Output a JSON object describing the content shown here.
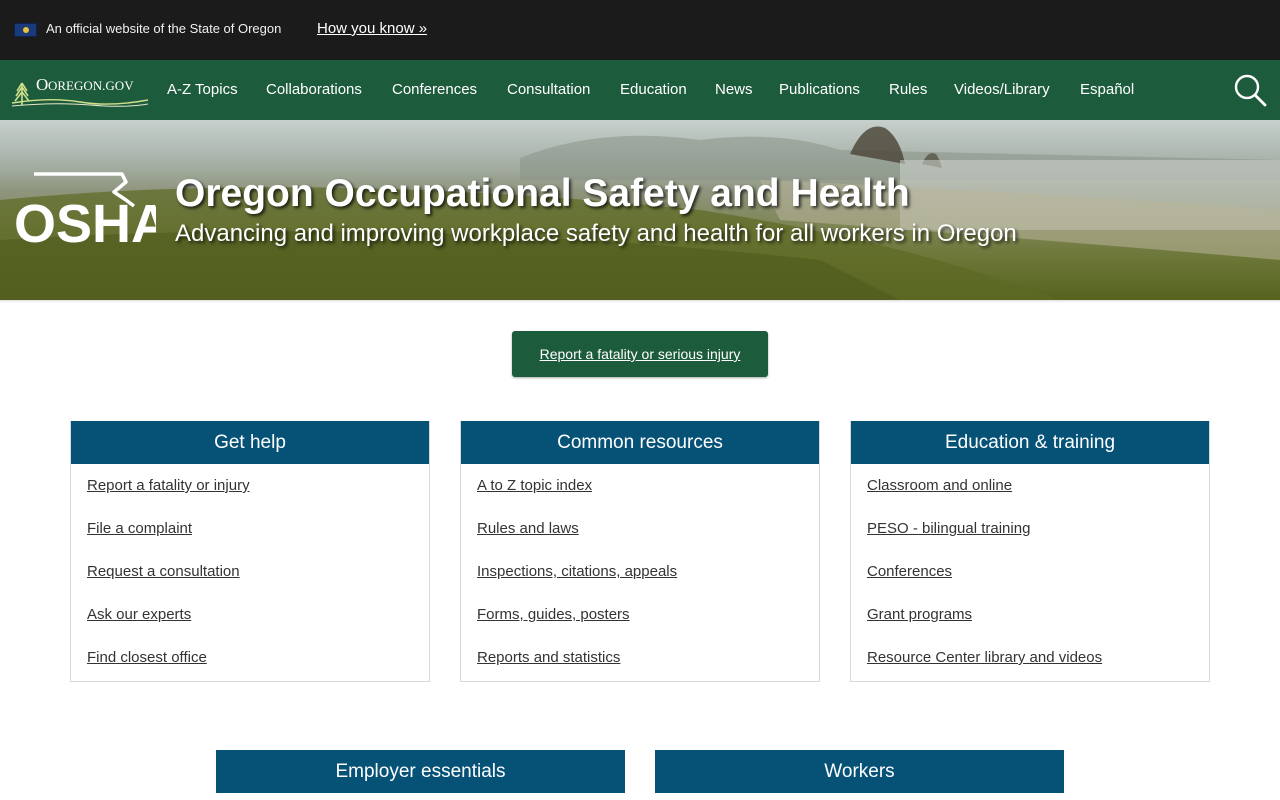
{
  "banner": {
    "official_text": "An official website of the State of Oregon",
    "how_you_know": "How you know »"
  },
  "nav": {
    "logo_text": "OREGON.GOV",
    "items": [
      "A-Z Topics",
      "Collaborations",
      "Conferences",
      "Consultation",
      "Education",
      "News",
      "Publications",
      "Rules",
      "Videos/Library",
      "Español"
    ],
    "search_icon": "search-icon"
  },
  "hero": {
    "logo_text": "OSHA",
    "title": "Oregon Occupational Safety and Health",
    "subtitle": "Advancing and improving workplace safety and health for all workers in Oregon"
  },
  "cta": {
    "label": "Report a fatality or serious injury"
  },
  "cards": [
    {
      "title": "Get help",
      "links": [
        "Report a fatality or injury",
        "File a complaint",
        "Request a consultation",
        "Ask our experts",
        "Find closest office"
      ]
    },
    {
      "title": "Common resources",
      "links": [
        "A to Z topic index",
        "Rules and laws",
        "Inspections, citations, appeals",
        "Forms, guides, posters",
        "Reports and statistics"
      ]
    },
    {
      "title": "Education & training",
      "links": [
        "Classroom and online",
        "PESO - bilingual training",
        "Conferences",
        "Grant programs",
        "Resource Center library and videos"
      ]
    }
  ],
  "cards_row2": [
    {
      "title": "Employer essentials"
    },
    {
      "title": "Workers"
    }
  ],
  "colors": {
    "banner_bg": "#1b1b1b",
    "nav_bg": "#1d5b3d",
    "card_header_bg": "#065277",
    "cta_bg": "#1d5b3d"
  }
}
